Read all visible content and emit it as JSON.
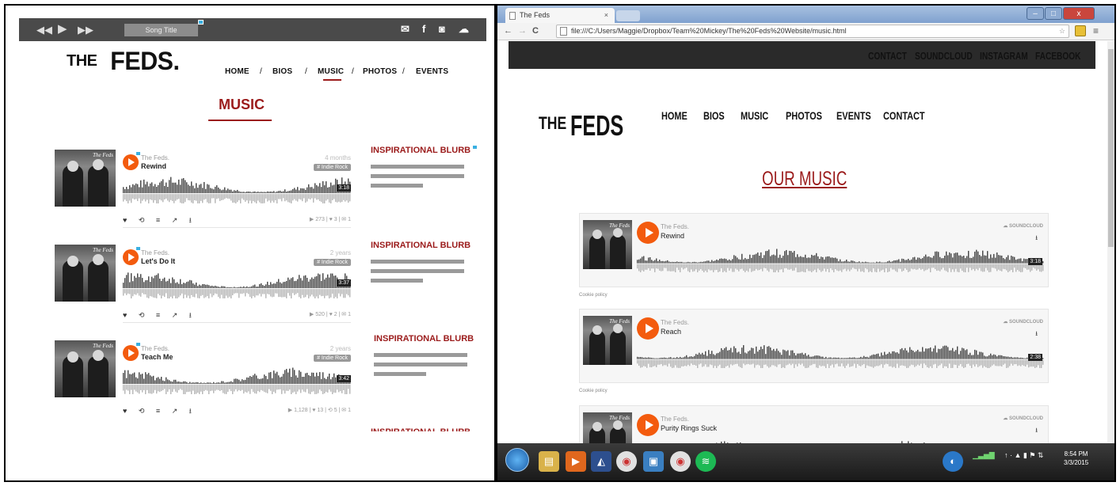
{
  "left_mockup": {
    "player": {
      "song_title": "Song Title",
      "controls": [
        "rewind-icon",
        "play-icon",
        "forward-icon"
      ],
      "social_icons": [
        "mail-icon",
        "facebook-icon",
        "instagram-icon",
        "soundcloud-icon"
      ]
    },
    "logo": {
      "the": "THE",
      "feds": "FEDS."
    },
    "nav": [
      "HOME",
      "BIOS",
      "MUSIC",
      "PHOTOS",
      "EVENTS"
    ],
    "nav_separator": "/",
    "heading": "MUSIC",
    "tracks": [
      {
        "artist": "The Feds.",
        "title": "Rewind",
        "time_ago": "4 months",
        "tag": "# Indie Rock",
        "duration": "3:18",
        "actions": "♥ ⟲ ≡ ↗ ⭳",
        "stats": "▶ 273 | ♥ 3 | ✉ 1"
      },
      {
        "artist": "The Feds.",
        "title": "Let's Do It",
        "time_ago": "2 years",
        "tag": "# Indie Rock",
        "duration": "3:37",
        "actions": "♥ ⟲ ≡ ↗ ⭳",
        "stats": "▶ 520 | ♥ 2 | ✉ 1"
      },
      {
        "artist": "The Feds.",
        "title": "Teach Me",
        "time_ago": "2 years",
        "tag": "# Indie Rock",
        "duration": "3:42",
        "actions": "♥ ⟲ ≡ ↗ ⭳",
        "stats": "▶ 1,128 | ♥ 13 | ⟲ 5 | ✉ 1"
      }
    ],
    "blurb_title": "INSPIRATIONAL BLURB"
  },
  "browser": {
    "tab_title": "The Feds",
    "tab_close": "×",
    "url": "file:///C:/Users/Maggie/Dropbox/Team%20Mickey/The%20Feds%20Website/music.html",
    "window_buttons": [
      "–",
      "□",
      "x"
    ],
    "header_links": [
      "CONTACT",
      "SOUNDCLOUD",
      "INSTAGRAM",
      "FACEBOOK"
    ],
    "logo": {
      "the": "THE",
      "feds": "FEDS"
    },
    "nav": [
      "HOME",
      "BIOS",
      "MUSIC",
      "PHOTOS",
      "EVENTS",
      "CONTACT"
    ],
    "heading": "OUR MUSIC",
    "soundcloud_label": "SOUNDCLOUD",
    "cookie_policy": "Cookie policy",
    "tracks": [
      {
        "artist": "The Feds.",
        "title": "Rewind",
        "duration": "3:18"
      },
      {
        "artist": "The Feds.",
        "title": "Reach",
        "duration": "2:38"
      },
      {
        "artist": "The Feds.",
        "title": "Purity Rings Suck",
        "duration": ""
      }
    ],
    "taskbar": {
      "time": "8:54 PM",
      "date": "3/3/2015"
    }
  },
  "colors": {
    "accent": "#9b1b1b",
    "player_orange": "#f35b0e",
    "badge_blue": "#3ab0e2",
    "dark_bar": "#2a2a2a"
  }
}
